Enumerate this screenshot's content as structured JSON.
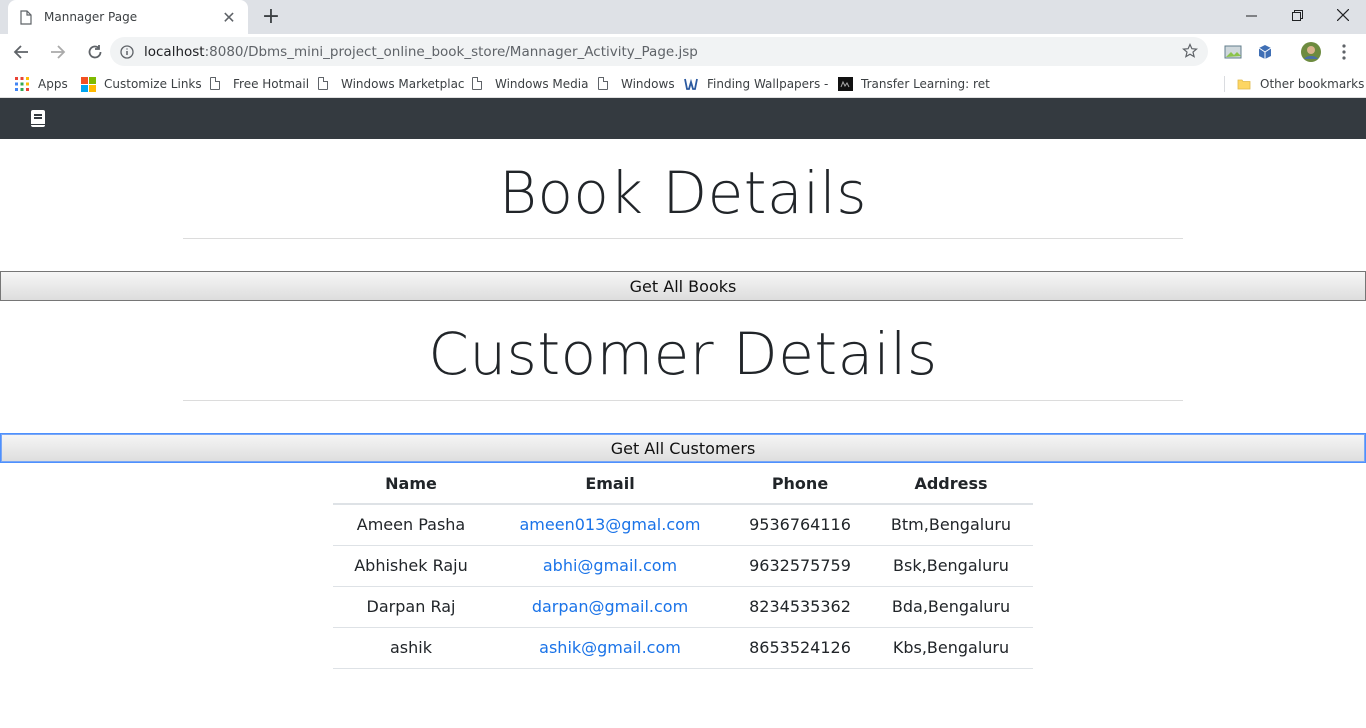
{
  "browser": {
    "tab_title": "Mannager Page",
    "url_host": "localhost",
    "url_rest": ":8080/Dbms_mini_project_online_book_store/Mannager_Activity_Page.jsp"
  },
  "bookmarks": [
    {
      "label": "Apps",
      "icon": "apps-grid-icon"
    },
    {
      "label": "Customize Links",
      "icon": "windows-logo-icon"
    },
    {
      "label": "Free Hotmail",
      "icon": "page-icon"
    },
    {
      "label": "Windows Marketplac",
      "icon": "page-icon"
    },
    {
      "label": "Windows Media",
      "icon": "page-icon"
    },
    {
      "label": "Windows",
      "icon": "page-icon"
    },
    {
      "label": "Finding Wallpapers -",
      "icon": "wallpaper-site-icon"
    },
    {
      "label": "Transfer Learning: ret",
      "icon": "article-thumb-icon"
    },
    {
      "label": "Other bookmarks",
      "icon": "folder-icon"
    }
  ],
  "page": {
    "book_heading": "Book Details",
    "get_books_label": "Get All Books",
    "customer_heading": "Customer Details",
    "get_customers_label": "Get All Customers"
  },
  "table": {
    "headers": [
      "Name",
      "Email",
      "Phone",
      "Address"
    ],
    "rows": [
      {
        "name": "Ameen Pasha",
        "email": "ameen013@gmal.com",
        "phone": "9536764116",
        "address": "Btm,Bengaluru"
      },
      {
        "name": "Abhishek Raju",
        "email": "abhi@gmail.com",
        "phone": "9632575759",
        "address": "Bsk,Bengaluru"
      },
      {
        "name": "Darpan Raj",
        "email": "darpan@gmail.com",
        "phone": "8234535362",
        "address": "Bda,Bengaluru"
      },
      {
        "name": "ashik",
        "email": "ashik@gmail.com",
        "phone": "8653524126",
        "address": "Kbs,Bengaluru"
      }
    ]
  },
  "colors": {
    "navbar": "#343a40",
    "link": "#1a73e8",
    "tabstrip": "#dee1e6"
  }
}
